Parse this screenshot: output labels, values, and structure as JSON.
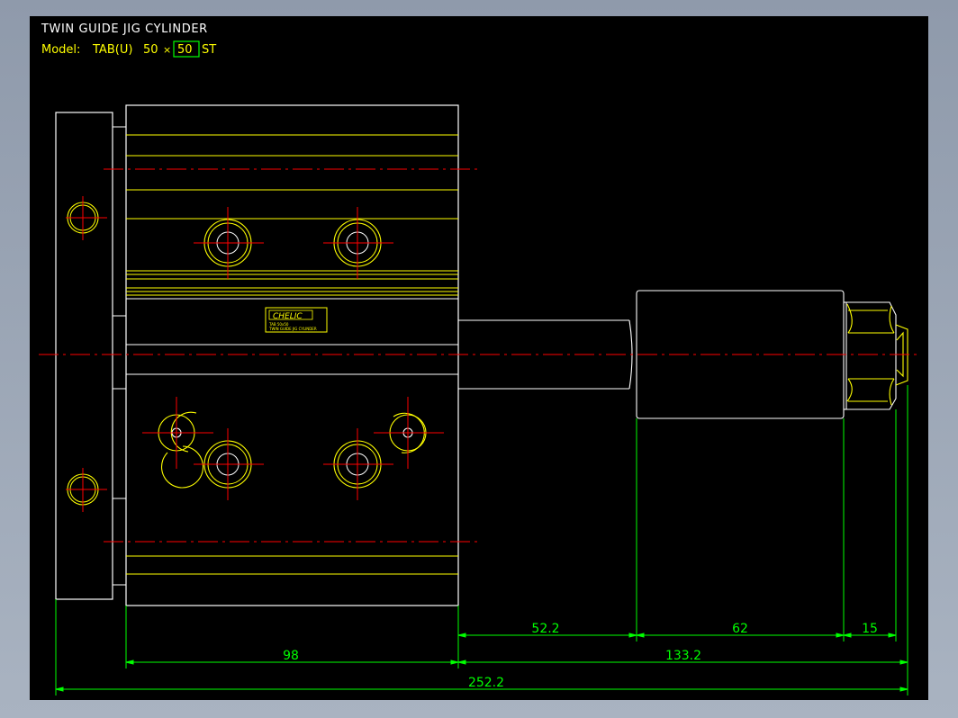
{
  "title": "TWIN GUIDE JIG CYLINDER",
  "model": {
    "prefix": "Model:",
    "series": "TAB(U)",
    "bore": "50",
    "times": "×",
    "stroke": "50",
    "suffix": "ST"
  },
  "nameplate": {
    "brand": "CHELIC",
    "line1": "TAB 50x50",
    "line2": "TWIN GUIDE JIG CYLINDER"
  },
  "dimensions": {
    "d1": "98",
    "d2": "52.2",
    "d3": "62",
    "d4": "15",
    "d5": "133.2",
    "d6": "252.2"
  },
  "colors": {
    "background": "#000000",
    "outline": "#ffffff",
    "detail": "#ffff00",
    "centerline": "#ff0000",
    "dimension": "#00ff00",
    "title_text": "#ffffff",
    "model_text": "#ffff00"
  }
}
